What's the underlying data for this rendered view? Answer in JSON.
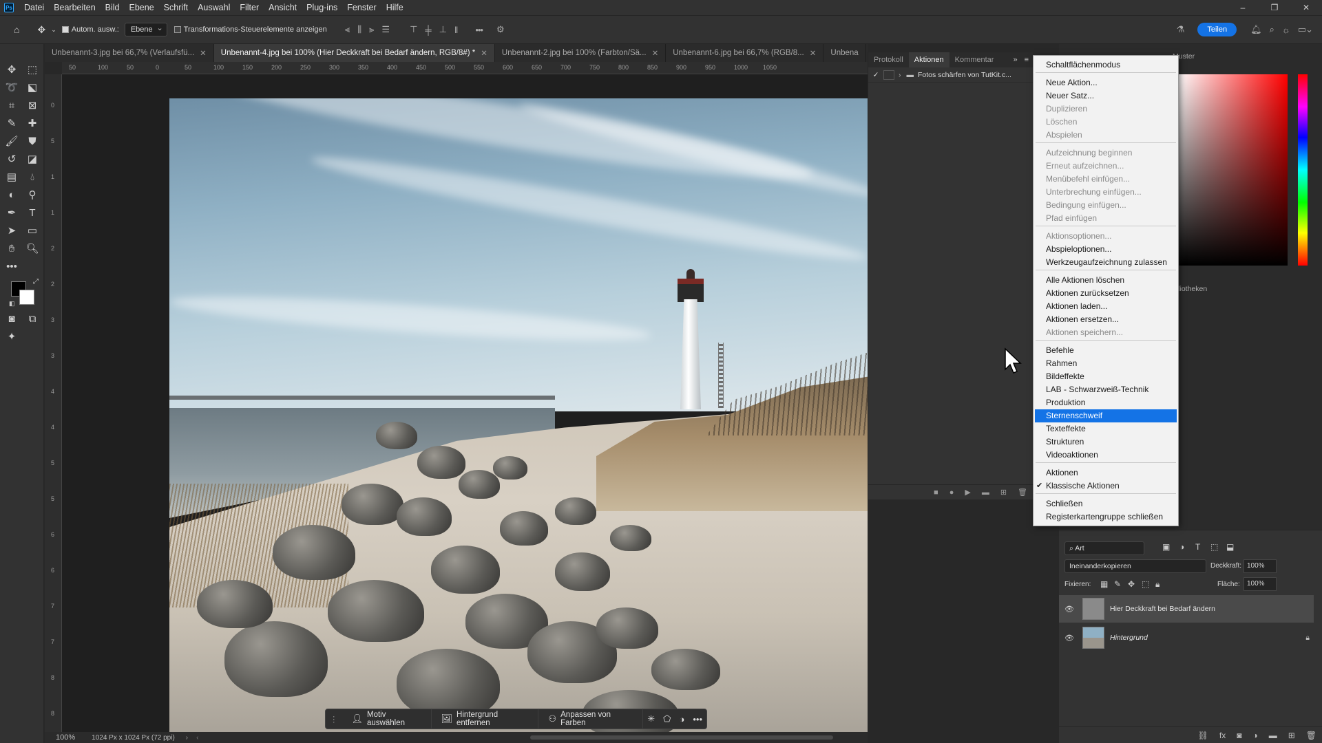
{
  "app": {
    "logo": "Ps"
  },
  "menubar": {
    "items": [
      "Datei",
      "Bearbeiten",
      "Bild",
      "Ebene",
      "Schrift",
      "Auswahl",
      "Filter",
      "Ansicht",
      "Plug-ins",
      "Fenster",
      "Hilfe"
    ]
  },
  "window_controls": {
    "minimize": "–",
    "maximize": "❐",
    "close": "✕"
  },
  "options": {
    "auto_select_label": "Autom. ausw.:",
    "auto_select_value": "Ebene",
    "transform_label": "Transformations-Steuerelemente anzeigen",
    "share_label": "Teilen"
  },
  "tabs": [
    {
      "title": "Unbenannt-3.jpg bei 66,7% (Verlaufsfü...",
      "active": false
    },
    {
      "title": "Unbenannt-4.jpg bei 100% (Hier Deckkraft bei Bedarf ändern, RGB/8#) *",
      "active": true
    },
    {
      "title": "Unbenannt-2.jpg bei 100% (Farbton/Sä...",
      "active": false
    },
    {
      "title": "Unbenannt-6.jpg bei 66,7% (RGB/8...",
      "active": false
    },
    {
      "title": "Unbena",
      "active": false
    }
  ],
  "ruler": {
    "h": [
      "50",
      "100",
      "50",
      "0",
      "50",
      "100",
      "150",
      "200",
      "250",
      "300",
      "350",
      "400",
      "450",
      "500",
      "550",
      "600",
      "650",
      "700",
      "750",
      "800",
      "850",
      "900",
      "950",
      "1000",
      "1050"
    ],
    "v": [
      "0",
      "5",
      "1",
      "1",
      "2",
      "2",
      "3",
      "3",
      "4",
      "4",
      "5",
      "5",
      "6",
      "6",
      "7",
      "7",
      "8",
      "8"
    ]
  },
  "context_bar": {
    "select_subject": "Motiv auswählen",
    "remove_bg": "Hintergrund entfernen",
    "adjust_colors": "Anpassen von Farben",
    "more": "•••"
  },
  "status": {
    "zoom": "100%",
    "doc_info": "1024 Px x 1024 Px (72 ppi)"
  },
  "actions_panel": {
    "tabs": [
      {
        "label": "Protokoll",
        "active": false
      },
      {
        "label": "Aktionen",
        "active": true
      },
      {
        "label": "Kommentar",
        "active": false
      }
    ],
    "set_name": "Fotos schärfen von TutKit.c..."
  },
  "right_panel": {
    "muster_tab": "Muster",
    "libraries_tab": "ibliotheken"
  },
  "layers": {
    "filter_kind": "Art",
    "blend_mode": "Ineinanderkopieren",
    "opacity_label": "Deckkraft:",
    "opacity_value": "100%",
    "lock_label": "Fixieren:",
    "fill_label": "Fläche:",
    "fill_value": "100%",
    "items": [
      {
        "name": "Hier Deckkraft bei Bedarf ändern",
        "italic": false,
        "selected": true
      },
      {
        "name": "Hintergrund",
        "italic": true,
        "selected": false
      }
    ]
  },
  "flyout_menu": {
    "items": [
      {
        "label": "Schaltflächenmodus",
        "enabled": true
      },
      {
        "sep": true
      },
      {
        "label": "Neue Aktion...",
        "enabled": true
      },
      {
        "label": "Neuer Satz...",
        "enabled": true
      },
      {
        "label": "Duplizieren",
        "enabled": false
      },
      {
        "label": "Löschen",
        "enabled": false
      },
      {
        "label": "Abspielen",
        "enabled": false
      },
      {
        "sep": true
      },
      {
        "label": "Aufzeichnung beginnen",
        "enabled": false
      },
      {
        "label": "Erneut aufzeichnen...",
        "enabled": false
      },
      {
        "label": "Menübefehl einfügen...",
        "enabled": false
      },
      {
        "label": "Unterbrechung einfügen...",
        "enabled": false
      },
      {
        "label": "Bedingung einfügen...",
        "enabled": false
      },
      {
        "label": "Pfad einfügen",
        "enabled": false
      },
      {
        "sep": true
      },
      {
        "label": "Aktionsoptionen...",
        "enabled": false
      },
      {
        "label": "Abspieloptionen...",
        "enabled": true
      },
      {
        "label": "Werkzeugaufzeichnung zulassen",
        "enabled": true
      },
      {
        "sep": true
      },
      {
        "label": "Alle Aktionen löschen",
        "enabled": true
      },
      {
        "label": "Aktionen zurücksetzen",
        "enabled": true
      },
      {
        "label": "Aktionen laden...",
        "enabled": true
      },
      {
        "label": "Aktionen ersetzen...",
        "enabled": true
      },
      {
        "label": "Aktionen speichern...",
        "enabled": false
      },
      {
        "sep": true
      },
      {
        "label": "Befehle",
        "enabled": true
      },
      {
        "label": "Rahmen",
        "enabled": true
      },
      {
        "label": "Bildeffekte",
        "enabled": true
      },
      {
        "label": "LAB - Schwarzweiß-Technik",
        "enabled": true
      },
      {
        "label": "Produktion",
        "enabled": true
      },
      {
        "label": "Sternenschweif",
        "enabled": true,
        "highlighted": true
      },
      {
        "label": "Texteffekte",
        "enabled": true
      },
      {
        "label": "Strukturen",
        "enabled": true
      },
      {
        "label": "Videoaktionen",
        "enabled": true
      },
      {
        "sep": true
      },
      {
        "label": "Aktionen",
        "enabled": true
      },
      {
        "label": "Klassische Aktionen",
        "enabled": true,
        "checked": true
      },
      {
        "sep": true
      },
      {
        "label": "Schließen",
        "enabled": true
      },
      {
        "label": "Registerkartengruppe schließen",
        "enabled": true
      }
    ]
  },
  "colors": {
    "accent": "#1473e6",
    "panel": "#333333",
    "menu_bg": "#f2f2f2"
  }
}
